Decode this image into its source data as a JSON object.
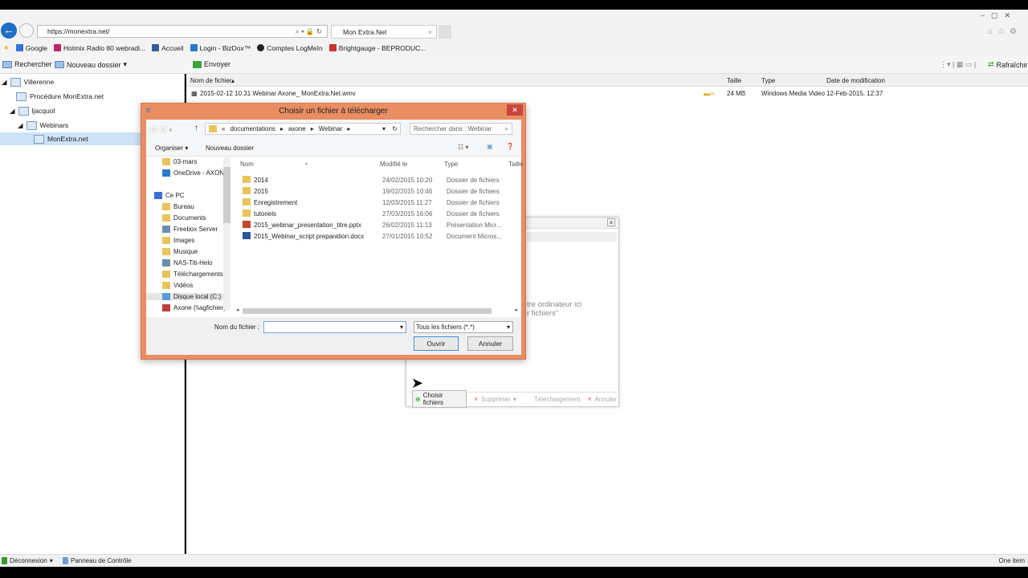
{
  "browser": {
    "url": "https://monextra.net/",
    "tab_title": "Mon Extra.Net",
    "favorites": [
      "Google",
      "Hotmix Radio 80 webradi...",
      "Accueil",
      "Login - BizDox™",
      "Comptes LogMeIn",
      "Brightgauge - BEPRODUC..."
    ]
  },
  "toolbar": {
    "search": "Rechercher",
    "new_folder": "Nouveau dossier",
    "send": "Envoyer",
    "refresh": "Rafraîchir"
  },
  "tree": {
    "items": [
      "Villerenne",
      "Procédure MonExtra.net",
      "ljacquol",
      "Webinars",
      "MonExtra.net"
    ]
  },
  "files": {
    "columns": {
      "name": "Nom de fichier",
      "size": "Taille",
      "type": "Type",
      "modified": "Date de modification"
    },
    "rows": [
      {
        "name": "2015-02-12 10.31 Webinar Axone_ MonExtra.Net.wmv",
        "size": "24 MB",
        "type": "Windows Media Video",
        "modified": "12-Feb-2015, 12:37"
      }
    ]
  },
  "dialog": {
    "title": "Choisir un fichier à télécharger",
    "breadcrumb": [
      "«",
      "documentations",
      "axone",
      "Webinar"
    ],
    "search_placeholder": "Rechercher dans : Webinar",
    "organize": "Organiser",
    "new_folder": "Nouveau dossier",
    "nav": [
      "03-mars",
      "OneDrive - AXONE",
      "Ce PC",
      "Bureau",
      "Documents",
      "Freebox Server",
      "Images",
      "Musique",
      "NAS-Titi-Helo",
      "Téléchargements",
      "Vidéos",
      "Disque local (C:)",
      "Axone (\\\\agfichier)"
    ],
    "columns": {
      "name": "Nom",
      "modified": "Modifié le",
      "type": "Type",
      "size": "Taille"
    },
    "rows": [
      {
        "name": "2014",
        "modified": "24/02/2015 10:20",
        "type": "Dossier de fichiers",
        "icon": "folder"
      },
      {
        "name": "2015",
        "modified": "19/02/2015 10:46",
        "type": "Dossier de fichiers",
        "icon": "folder"
      },
      {
        "name": "Enregistrement",
        "modified": "12/03/2015 11:27",
        "type": "Dossier de fichiers",
        "icon": "folder"
      },
      {
        "name": "tutoriels",
        "modified": "27/03/2015 16:06",
        "type": "Dossier de fichiers",
        "icon": "folder"
      },
      {
        "name": "2015_webinar_presentation_titre.pptx",
        "modified": "26/02/2015 11:13",
        "type": "Présentation Micr...",
        "icon": "pptx"
      },
      {
        "name": "2015_Webinar_script preparation.docx",
        "modified": "27/01/2015 10:52",
        "type": "Document Micros...",
        "icon": "docx"
      }
    ],
    "filename_label": "Nom du fichier :",
    "filename_value": "",
    "filter": "Tous les fichiers (*.*)",
    "open": "Ouvrir",
    "cancel": "Annuler"
  },
  "upload": {
    "hint1": "tre ordinateur ici",
    "hint2": "r fichiers\"",
    "choose": "Choisir fichiers",
    "delete": "Supprimer",
    "download": "Téléchargement",
    "cancel": "Annuler"
  },
  "status": {
    "logout": "Déconnexion",
    "control_panel": "Panneau de Contrôle",
    "count": "One item"
  },
  "colors": {
    "dialog_border": "#e98d62",
    "accent": "#1e6fc4"
  }
}
